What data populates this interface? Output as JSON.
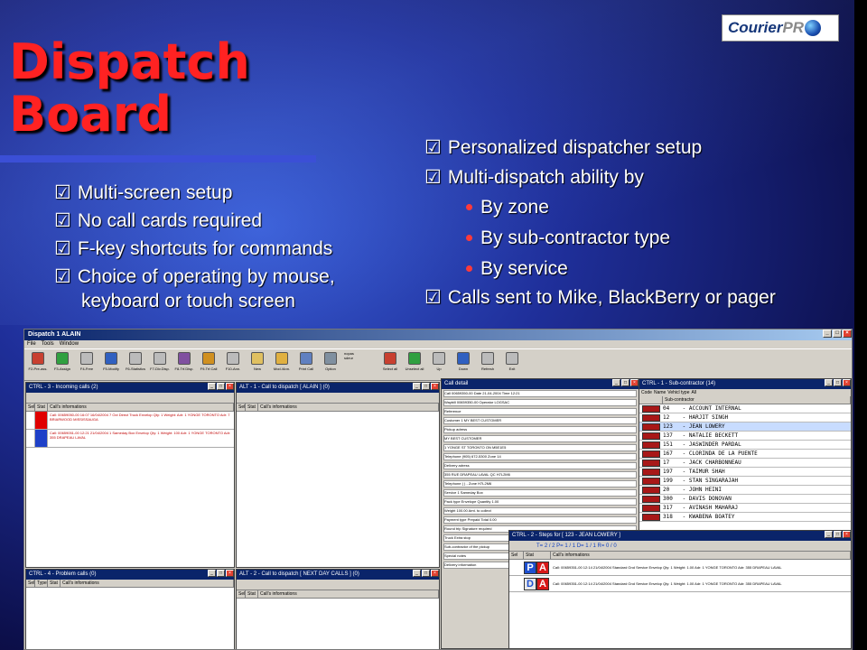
{
  "slide": {
    "title_line1": "Dispatch",
    "title_line2": "Board",
    "logo_text": "Courier",
    "logo_text_accent": "PR"
  },
  "left_bullets": [
    {
      "check": "☑",
      "text": "Multi-screen setup"
    },
    {
      "check": "☑",
      "text": "No call cards required"
    },
    {
      "check": "☑",
      "text": "F-key shortcuts for commands"
    },
    {
      "check": "☑",
      "text": "Choice of  operating by mouse,"
    }
  ],
  "left_bullet_continuation": "keyboard or touch screen",
  "right_bullets": {
    "b1": "Personalized dispatcher setup",
    "b2": "Multi-dispatch ability by",
    "sub": [
      "By zone",
      "By sub-contractor type",
      "By service"
    ],
    "b3": "Calls sent to Mike, BlackBerry or pager",
    "check": "☑"
  },
  "app": {
    "title": "Dispatch   1     ALAIN",
    "menu": [
      "File",
      "Tools",
      "Window"
    ],
    "toolbar": [
      "F2-Pre-ass.",
      "F3-Assign",
      "F4-Free",
      "F5-Modify",
      "F6-Statistics",
      "F7-Div.Disp.",
      "F8-Trf.Disp.",
      "F9-Trf.Call",
      "F10-Ann.",
      "New",
      "Mod./Ann.",
      "Print Call",
      "Option",
      "Select all",
      "Unselect all",
      "Up",
      "Down",
      "Refresh",
      "Exit"
    ],
    "toolbar_checks": [
      "nopas",
      "sdeur",
      "nopas",
      "sdeur"
    ],
    "panes": {
      "incoming": "CTRL - 3 - Incoming calls (2)",
      "alt1": "ALT - 1 - Call to dispatch [ ALAIN ] (0)",
      "problem": "CTRL - 4 - Problem calls (0)",
      "alt2": "ALT - 2 - Call to dispatch [ NEXT DAY CALLS ] (0)",
      "call_detail": "Call detail",
      "subcontractor": "CTRL - 1 - Sub-contractor (14)",
      "steps": "CTRL - 2 - Steps for [ 123 - JEAN LOWERY ]"
    },
    "incoming_cols": [
      "Sel",
      "Stat",
      "Call's informations"
    ],
    "alt_cols": [
      "Sel",
      "Stat",
      "Call's informations"
    ],
    "problem_cols": [
      "Sel",
      "Type",
      "Stat",
      "Call's informations"
    ],
    "incoming_calls": [
      "Call: 00659050-00 16:07 16/04/2004 7 Oct Direct Truck Envelop Qty: 1 Weight:   Adr: 1 YONGE TORONTO   Adr: 7 BRIARWOOD MISSISSAUGA",
      "Call: 00659051-00 12:21 21/04/2004 1 Sameday Box Envelop Qty: 1 Weight:   100   Adr: 1 YONGE TORONTO   Adr: 355 DRAPEAU LAVAL"
    ],
    "call_detail_fields": [
      "Call  00659350-00   Date  21-04-2004   Time  12:21",
      "Waybill  00659350-00   Operator  LOGSAC",
      "Reference",
      "Customer  1   MY BEST CUSTOMER",
      "Pickup adress",
      "MY BEST CUSTOMER",
      "1 YONGE ST TORONTO ON M5E1E5",
      "Telephone  (905) 672-5300   Zone  14",
      "Delivery adress",
      "355 RUE DRAPEAU LAVAL QC H7L2M6",
      "Telephone  ( )  -   Zone  H7L2M6",
      "Service  1  Sameday Box",
      "Pack type  Envelope   Quantity  1.00",
      "Weight  100.00   Amt. to collect",
      "Payment type  Prepaid   Total  0.00",
      "Round trip   Signature required",
      "Truck   Extra stop",
      "Sub-contractor of the pickup",
      "Special notes",
      "Delivery information"
    ],
    "subc_radios": [
      "Code",
      "Name",
      "Vehicl type",
      "All"
    ],
    "subc_header": "Sub-contractor",
    "subcontractors": [
      "04    - ACCOUNT INTERNAL",
      "12    - HARJIT SINGH",
      "123   - JEAN LOWERY",
      "137   - NATALIE BECKETT",
      "151   - JASWINDER PARDAL",
      "167   - CLORINDA DE LA PUENTE",
      "17    - JACK CHARBONNEAU",
      "197   - TAIMUR SHAH",
      "199   - STAN SINGARAJAH",
      "20    - JOHN HEINI",
      "300   - DAVIS DONOVAN",
      "317   - AVINASH MAHARAJ",
      "318   - KWABENA BOATEY"
    ],
    "steps_bar": "T=  2  /  2    P=  1  /  1    D=  1  /  1    R=  0  /  0",
    "steps_cols": [
      "Sel",
      "Stat",
      "Call's informations"
    ],
    "steps": [
      {
        "letter": "P",
        "info": "Call: 00659351-00 12:14 21/04/2004 Standard Gnd Service Envelop Qty: 1 Weight:   1.00 Adr: 1 YONGE TORONTO   Adr: 355 DRAPEAU LAVAL"
      },
      {
        "letter": "D",
        "info": "Call: 00659351-00 12:14 21/04/2004 Standard Gnd Service Envelop Qty: 1 Weight:   1.00 Adr: 1 YONGE TORONTO   Adr: 355 DRAPEAU LAVAL"
      }
    ]
  },
  "colors": {
    "title": "#ff2222",
    "pane_title": "#0a246a",
    "accent_rule": "#3b4fd6"
  }
}
